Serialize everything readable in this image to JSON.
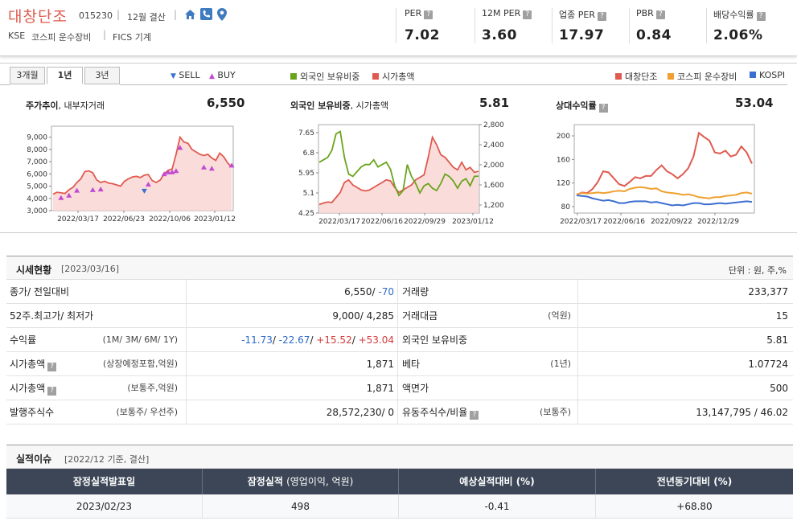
{
  "header": {
    "company": "대창단조",
    "code": "015230",
    "fiscal": "12월 결산",
    "market": "KSE",
    "sector1": "코스피 운수장비",
    "sector2": "FICS 기계",
    "metrics": [
      {
        "label": "PER",
        "value": "7.02"
      },
      {
        "label": "12M PER",
        "value": "3.60"
      },
      {
        "label": "업종 PER",
        "value": "17.97"
      },
      {
        "label": "PBR",
        "value": "0.84"
      },
      {
        "label": "배당수익률",
        "value": "2.06%"
      }
    ]
  },
  "chart_tabs": [
    "3개월",
    "1년",
    "3년"
  ],
  "legend": {
    "sell": "SELL",
    "buy": "BUY",
    "foreign": "외국인 보유비중",
    "mktcap": "시가총액",
    "company": "대창단조",
    "sector": "코스피 운수장비",
    "index": "KOSPI"
  },
  "colors": {
    "red": "#e05a4f",
    "green": "#6aa41c",
    "orange": "#f0a030",
    "blue": "#3b6fd0",
    "buy": "#c04ad0",
    "sell": "#3b6fd0"
  },
  "panels": {
    "p1": {
      "title_b": "주가추이",
      "title_r": ", 내부자거래",
      "value": "6,550"
    },
    "p2": {
      "title_b": "외국인 보유비중",
      "title_r": ", 시가총액",
      "value": "5.81"
    },
    "p3": {
      "title_b": "상대수익률",
      "value": "53.04"
    }
  },
  "chart_data": [
    {
      "type": "area",
      "title": "주가추이, 내부자거래",
      "x_ticks": [
        "2022/03/17",
        "2022/06/23",
        "2022/10/06",
        "2023/01/12"
      ],
      "y_ticks": [
        "9,000",
        "8,000",
        "7,000",
        "6,000",
        "5,000",
        "4,000",
        "3,000"
      ],
      "ylim": [
        3000,
        9500
      ],
      "series": [
        {
          "name": "대창단조",
          "values": [
            4350,
            4500,
            4450,
            4400,
            4700,
            4900,
            5300,
            5600,
            6200,
            6250,
            6100,
            5500,
            5300,
            5400,
            5250,
            5200,
            5100,
            5000,
            5400,
            5600,
            5750,
            5800,
            5700,
            5900,
            5950,
            5450,
            5300,
            5500,
            6000,
            6300,
            6400,
            7600,
            9000,
            8600,
            8500,
            8000,
            7800,
            7600,
            7500,
            7600,
            7300,
            7100,
            7700,
            7400,
            6900,
            6550
          ]
        }
      ],
      "buy": [
        [
          2,
          4000
        ],
        [
          4,
          4200
        ],
        [
          6,
          4600
        ],
        [
          10,
          4650
        ],
        [
          12,
          4700
        ],
        [
          24,
          5100
        ],
        [
          28,
          5950
        ],
        [
          29,
          6100
        ],
        [
          30,
          6100
        ],
        [
          31,
          6200
        ],
        [
          32,
          8100
        ],
        [
          38,
          6500
        ],
        [
          40,
          6400
        ],
        [
          45,
          6650
        ]
      ],
      "sell": [
        [
          23,
          4650
        ]
      ]
    },
    {
      "type": "line",
      "title": "외국인 보유비중, 시가총액",
      "x_ticks": [
        "2022/03/17",
        "2022/06/16",
        "2022/09/29",
        "2023/01/12"
      ],
      "y_ticks_left": [
        "7.65",
        "6.8",
        "5.95",
        "5.1",
        "4.25"
      ],
      "y_ticks_right": [
        "2,800",
        "2,400",
        "2,000",
        "1,600",
        "1,200"
      ],
      "series": [
        {
          "name": "외국인 보유비중",
          "values": [
            6.4,
            6.5,
            6.6,
            6.9,
            7.6,
            7.7,
            6.6,
            5.9,
            5.8,
            6.0,
            6.2,
            6.3,
            6.3,
            6.5,
            6.2,
            6.3,
            6.4,
            6.1,
            5.4,
            5.0,
            5.2,
            6.3,
            5.8,
            5.5,
            5.1,
            5.4,
            5.5,
            5.3,
            5.2,
            5.5,
            5.9,
            5.8,
            5.6,
            5.3,
            5.6,
            5.7,
            5.4,
            5.8,
            5.81
          ]
        },
        {
          "name": "시가총액",
          "values": [
            1210,
            1240,
            1260,
            1250,
            1350,
            1450,
            1650,
            1700,
            1600,
            1550,
            1500,
            1480,
            1500,
            1550,
            1600,
            1650,
            1700,
            1680,
            1550,
            1450,
            1500,
            1550,
            1600,
            1700,
            1750,
            1800,
            2150,
            2550,
            2400,
            2200,
            2150,
            2050,
            1950,
            1900,
            2050,
            1900,
            1950,
            1850,
            1871
          ]
        }
      ]
    },
    {
      "type": "line",
      "title": "상대수익률",
      "x_ticks": [
        "2022/03/17",
        "2022/06/16",
        "2022/09/22",
        "2022/12/29"
      ],
      "y_ticks": [
        "200",
        "160",
        "120",
        "80"
      ],
      "series": [
        {
          "name": "대창단조",
          "values": [
            100,
            104,
            103,
            110,
            122,
            140,
            138,
            128,
            118,
            115,
            122,
            130,
            128,
            132,
            132,
            142,
            150,
            140,
            135,
            128,
            135,
            145,
            165,
            205,
            198,
            192,
            172,
            170,
            175,
            165,
            168,
            182,
            172,
            153
          ]
        },
        {
          "name": "코스피 운수장비",
          "values": [
            101,
            103,
            102,
            103,
            104,
            103,
            104,
            106,
            107,
            106,
            110,
            112,
            113,
            112,
            110,
            111,
            106,
            104,
            103,
            102,
            100,
            101,
            99,
            96,
            95,
            94,
            96,
            96,
            98,
            99,
            100,
            103,
            104,
            102
          ]
        },
        {
          "name": "KOSPI",
          "values": [
            99,
            98,
            97,
            94,
            92,
            90,
            91,
            89,
            86,
            86,
            88,
            89,
            89,
            89,
            87,
            88,
            86,
            84,
            82,
            83,
            82,
            84,
            86,
            86,
            84,
            84,
            85,
            86,
            85,
            86,
            87,
            88,
            89,
            88
          ]
        }
      ]
    }
  ],
  "market": {
    "title": "시세현황",
    "date": "[2023/03/16]",
    "unit": "단위 : 원, 주,%",
    "rows": [
      {
        "l_label": "종가/ 전일대비",
        "l_sub": "",
        "l_val1": "6,550/ ",
        "l_val2": "-70",
        "r_label": "거래량",
        "r_sub": "",
        "r_val": "233,377"
      },
      {
        "l_label": "52주.최고가/ 최저가",
        "l_sub": "",
        "l_val1": "9,000/ 4,285",
        "l_val2": "",
        "r_label": "거래대금",
        "r_sub": "(억원)",
        "r_val": "15"
      },
      {
        "l_label": "수익률",
        "l_sub": "(1M/ 3M/ 6M/ 1Y)",
        "l_val1": "",
        "l_val2": "",
        "r_label": "외국인 보유비중",
        "r_sub": "",
        "r_val": "5.81"
      },
      {
        "l_label": "시가총액",
        "l_sub": "(상장예정포함,억원)",
        "l_val1": "1,871",
        "l_val2": "",
        "r_label": "베타",
        "r_sub": "(1년)",
        "r_val": "1.07724"
      },
      {
        "l_label": "시가총액",
        "l_sub": "(보통주,억원)",
        "l_val1": "1,871",
        "l_val2": "",
        "r_label": "액면가",
        "r_sub": "",
        "r_val": "500"
      },
      {
        "l_label": "발행주식수",
        "l_sub": "(보통주/ 우선주)",
        "l_val1": "28,572,230/ 0",
        "l_val2": "",
        "r_label": "유동주식수/비율",
        "r_sub": "(보통주)",
        "r_val": "13,147,795 / 46.02"
      }
    ],
    "returns": [
      "-11.73",
      "-22.67",
      "+15.52",
      "+53.04"
    ]
  },
  "earnings": {
    "title": "실적이슈",
    "sub": "[2022/12 기준, 결산]",
    "headers": [
      "잠정실적발표일",
      "잠정실적",
      "(영업이익, 억원)",
      "예상실적대비 (%)",
      "전년동기대비 (%)"
    ],
    "row": [
      "2023/02/23",
      "498",
      "-0.41",
      "+68.80"
    ]
  }
}
